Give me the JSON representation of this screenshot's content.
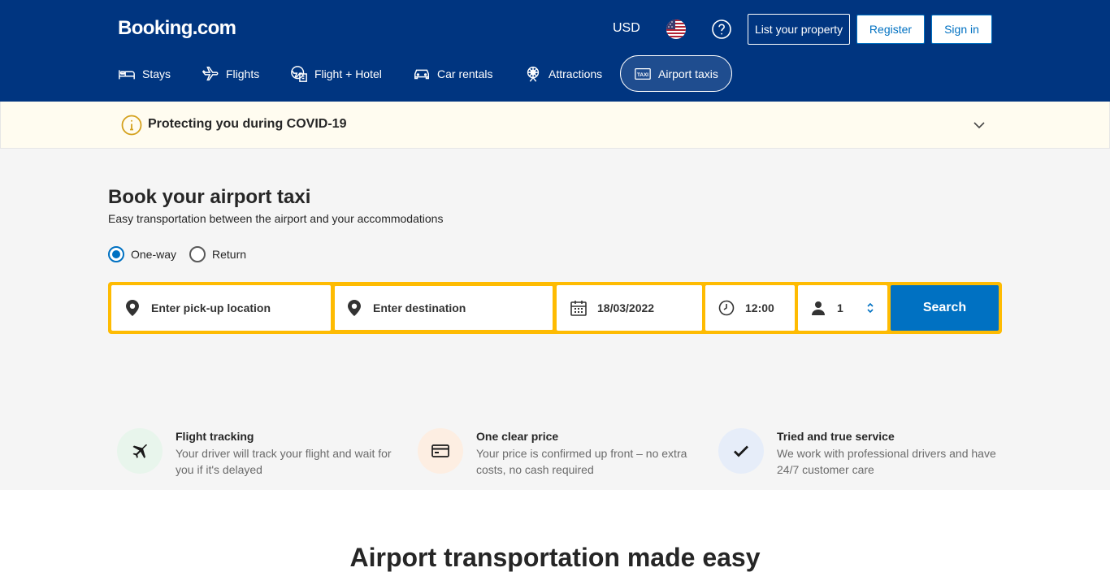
{
  "header": {
    "logo": "Booking.com",
    "currency": "USD",
    "list_property": "List your property",
    "register": "Register",
    "sign_in": "Sign in"
  },
  "nav": [
    {
      "label": "Stays",
      "icon": "bed-icon"
    },
    {
      "label": "Flights",
      "icon": "plane-icon"
    },
    {
      "label": "Flight + Hotel",
      "icon": "flight-hotel-icon"
    },
    {
      "label": "Car rentals",
      "icon": "car-icon"
    },
    {
      "label": "Attractions",
      "icon": "attractions-icon"
    },
    {
      "label": "Airport taxis",
      "icon": "taxi-icon",
      "active": true
    }
  ],
  "covid": {
    "text": "Protecting you during COVID-19"
  },
  "hero": {
    "title": "Book your airport taxi",
    "subtitle": "Easy transportation between the airport and your accommodations"
  },
  "trip_type": {
    "options": [
      "One-way",
      "Return"
    ],
    "selected": "One-way"
  },
  "search_form": {
    "pickup_placeholder": "Enter pick-up location",
    "destination_placeholder": "Enter destination",
    "date": "18/03/2022",
    "time": "12:00",
    "passengers": "1",
    "search_label": "Search"
  },
  "features": [
    {
      "title": "Flight tracking",
      "description": "Your driver will track your flight and wait for you if it's delayed",
      "icon": "plane-icon",
      "bg": "#e8f5ec"
    },
    {
      "title": "One clear price",
      "description": "Your price is confirmed up front – no extra costs, no cash required",
      "icon": "card-icon",
      "bg": "#fdeee2"
    },
    {
      "title": "Tried and true service",
      "description": "We work with professional drivers and have 24/7 customer care",
      "icon": "check-icon",
      "bg": "#e6edf9"
    }
  ],
  "section": {
    "title": "Airport transportation made easy"
  },
  "colors": {
    "brand_navy": "#003580",
    "accent_blue": "#0071c2",
    "search_yellow": "#febb02"
  }
}
